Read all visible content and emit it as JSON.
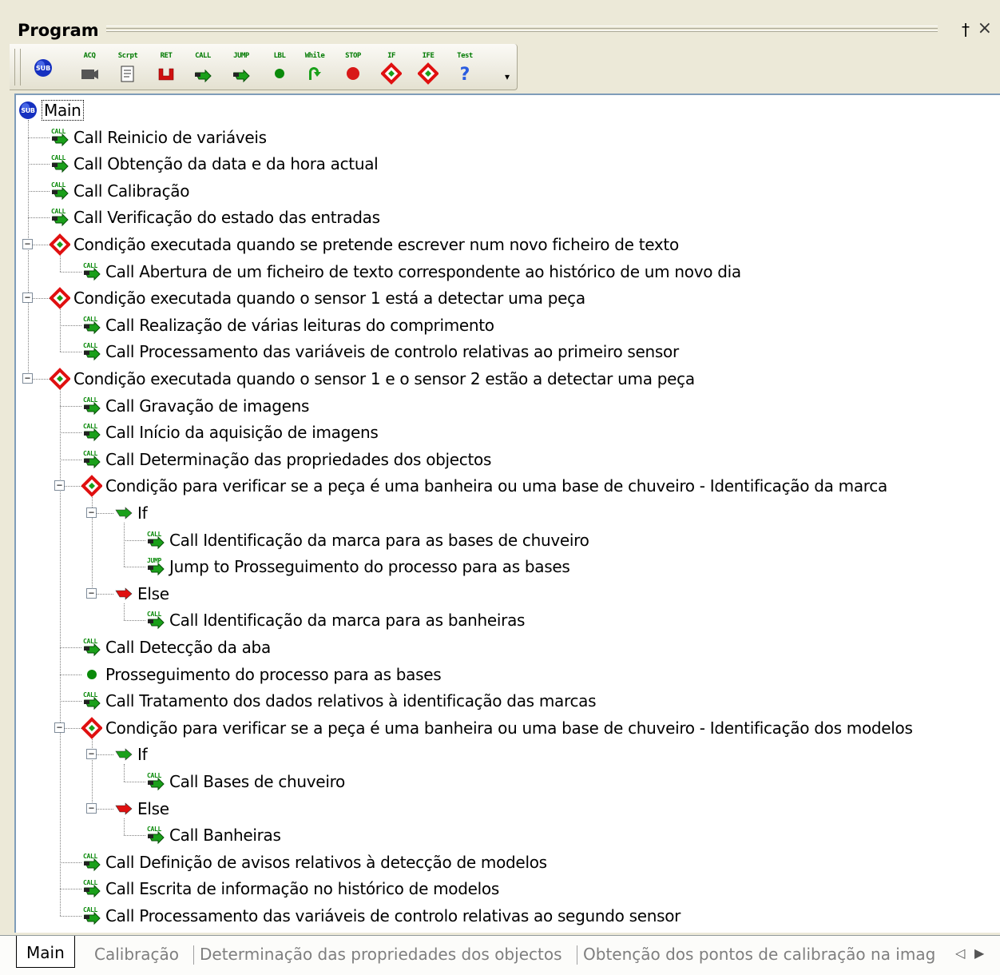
{
  "panel": {
    "title": "Program",
    "pin_glyph": "†",
    "close_glyph": "×"
  },
  "toolbar": {
    "buttons": [
      {
        "label": "",
        "icon": "sub-icon"
      },
      {
        "label": "ACQ",
        "icon": "camera-icon"
      },
      {
        "label": "Scrpt",
        "icon": "script-icon"
      },
      {
        "label": "RET",
        "icon": "return-icon"
      },
      {
        "label": "CALL",
        "icon": "call-arrow-icon"
      },
      {
        "label": "JUMP",
        "icon": "jump-arrow-icon"
      },
      {
        "label": "LBL",
        "icon": "label-dot-icon"
      },
      {
        "label": "While",
        "icon": "while-loop-icon"
      },
      {
        "label": "STOP",
        "icon": "stop-icon"
      },
      {
        "label": "IF",
        "icon": "if-diamond-icon"
      },
      {
        "label": "IFE",
        "icon": "ife-diamond-icon"
      },
      {
        "label": "Test",
        "icon": "question-icon"
      }
    ],
    "dropdown_glyph": "▾"
  },
  "tree": {
    "nodes": [
      {
        "text": "Main",
        "icon": "sub-icon",
        "depth": 0
      },
      {
        "text": "Call Reinicio de variáveis",
        "icon": "call-icon",
        "depth": 1
      },
      {
        "text": "Call Obtenção da data e da hora actual",
        "icon": "call-icon",
        "depth": 1
      },
      {
        "text": "Call Calibração",
        "icon": "call-icon",
        "depth": 1
      },
      {
        "text": "Call Verificação do estado das entradas",
        "icon": "call-icon",
        "depth": 1
      },
      {
        "text": "Condição executada quando se pretende escrever num novo ficheiro de texto",
        "icon": "if-icon",
        "depth": 1
      },
      {
        "text": "Call Abertura de um ficheiro de texto correspondente ao histórico de um novo dia",
        "icon": "call-icon",
        "depth": 2
      },
      {
        "text": "Condição executada quando o sensor 1 está a detectar uma peça",
        "icon": "if-icon",
        "depth": 1
      },
      {
        "text": "Call Realização de várias leituras do comprimento",
        "icon": "call-icon",
        "depth": 2
      },
      {
        "text": "Call Processamento das variáveis de controlo relativas ao primeiro sensor",
        "icon": "call-icon",
        "depth": 2
      },
      {
        "text": "Condição executada quando o sensor 1 e o sensor 2 estão a detectar uma peça",
        "icon": "if-icon",
        "depth": 1
      },
      {
        "text": "Call Gravação de imagens",
        "icon": "call-icon",
        "depth": 2
      },
      {
        "text": "Call Início da aquisição de imagens",
        "icon": "call-icon",
        "depth": 2
      },
      {
        "text": "Call Determinação das propriedades dos objectos",
        "icon": "call-icon",
        "depth": 2
      },
      {
        "text": "Condição para verificar se a peça é uma banheira ou uma base de chuveiro - Identificação da marca",
        "icon": "if-icon",
        "depth": 2
      },
      {
        "text": "If",
        "icon": "if-branch-icon",
        "depth": 3
      },
      {
        "text": "Call Identificação da marca para as bases de chuveiro",
        "icon": "call-icon",
        "depth": 4
      },
      {
        "text": "Jump to Prosseguimento do processo para as bases",
        "icon": "jump-icon",
        "depth": 4
      },
      {
        "text": "Else",
        "icon": "else-branch-icon",
        "depth": 3
      },
      {
        "text": "Call Identificação da marca para as banheiras",
        "icon": "call-icon",
        "depth": 4
      },
      {
        "text": "Call Detecção da aba",
        "icon": "call-icon",
        "depth": 2
      },
      {
        "text": "Prosseguimento do processo para as bases",
        "icon": "label-icon",
        "depth": 2
      },
      {
        "text": "Call Tratamento dos dados relativos à identificação das marcas",
        "icon": "call-icon",
        "depth": 2
      },
      {
        "text": "Condição para verificar se a peça é uma banheira ou uma base de chuveiro - Identificação dos modelos",
        "icon": "if-icon",
        "depth": 2
      },
      {
        "text": "If",
        "icon": "if-branch-icon",
        "depth": 3
      },
      {
        "text": "Call Bases de chuveiro",
        "icon": "call-icon",
        "depth": 4
      },
      {
        "text": "Else",
        "icon": "else-branch-icon",
        "depth": 3
      },
      {
        "text": "Call Banheiras",
        "icon": "call-icon",
        "depth": 4
      },
      {
        "text": "Call Definição de avisos relativos à detecção de modelos",
        "icon": "call-icon",
        "depth": 2
      },
      {
        "text": "Call Escrita de informação no histórico de modelos",
        "icon": "call-icon",
        "depth": 2
      },
      {
        "text": "Call Processamento das variáveis de controlo relativas ao segundo sensor",
        "icon": "call-icon",
        "depth": 2
      }
    ],
    "icon_labels": {
      "call": "CALL",
      "jump": "JUMP",
      "sub": "SUB"
    },
    "expander_glyph": "−"
  },
  "tabs": {
    "items": [
      "Main",
      "Calibração",
      "Determinação das propriedades dos objectos",
      "Obtenção dos pontos de calibração na imag"
    ],
    "active": "Main",
    "scroll_left": "◁",
    "scroll_right": "▶"
  },
  "colors": {
    "call_green": "#1aa01a",
    "if_red": "#e01010",
    "sub_blue": "#1530c0",
    "label_green": "#0a8a0a"
  }
}
